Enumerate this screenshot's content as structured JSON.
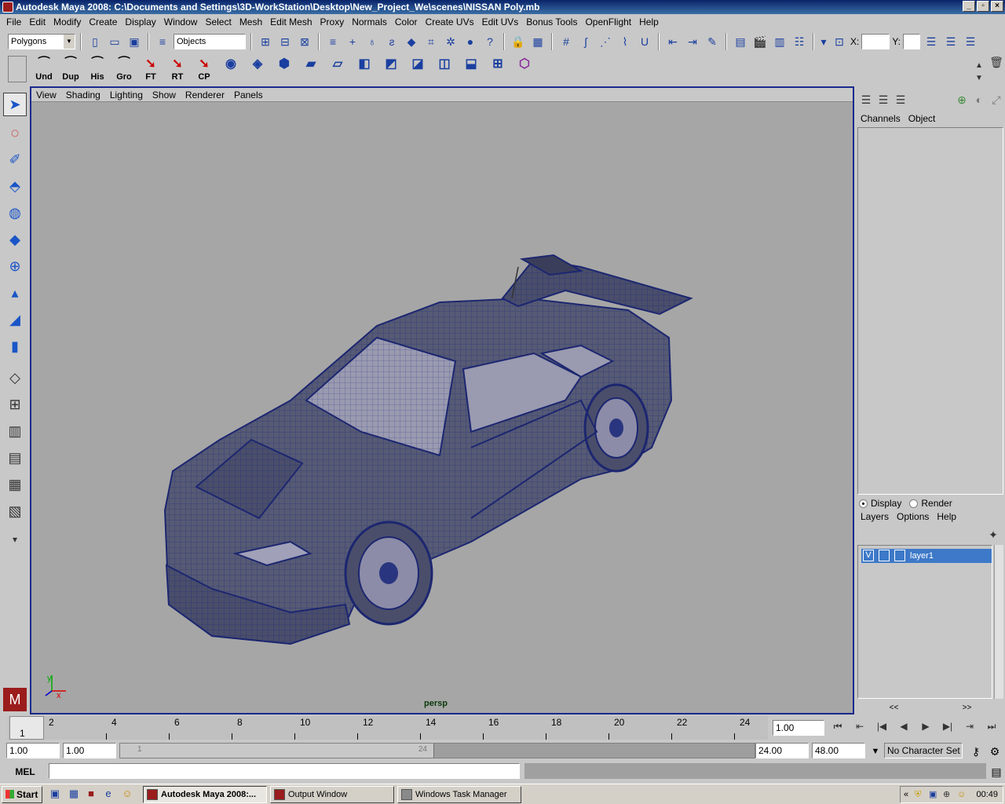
{
  "window": {
    "title": "Autodesk Maya 2008: C:\\Documents and Settings\\3D-WorkStation\\Desktop\\New_Project_We\\scenes\\NISSAN Poly.mb",
    "min": "_",
    "max": "▫",
    "close": "×"
  },
  "menus": [
    "File",
    "Edit",
    "Modify",
    "Create",
    "Display",
    "Window",
    "Select",
    "Mesh",
    "Edit Mesh",
    "Proxy",
    "Normals",
    "Color",
    "Create UVs",
    "Edit UVs",
    "Bonus Tools",
    "OpenFlight",
    "Help"
  ],
  "statusline": {
    "mode": "Polygons",
    "select_field": "Objects",
    "x_label": "X:",
    "y_label": "Y:"
  },
  "shelf": [
    {
      "label": "Und"
    },
    {
      "label": "Dup"
    },
    {
      "label": "His"
    },
    {
      "label": "Gro"
    },
    {
      "label": "FT"
    },
    {
      "label": "RT"
    },
    {
      "label": "CP"
    }
  ],
  "panel_menu": [
    "View",
    "Shading",
    "Lighting",
    "Show",
    "Renderer",
    "Panels"
  ],
  "viewport": {
    "camera": "persp",
    "axis_x": "x",
    "axis_y": "y"
  },
  "channel_box": {
    "tabs": [
      "Channels",
      "Object"
    ]
  },
  "layer_editor": {
    "display": "Display",
    "render": "Render",
    "menu": [
      "Layers",
      "Options",
      "Help"
    ],
    "layer_visible": "V",
    "layer_name": "layer1",
    "prev": "<<",
    "next": ">>"
  },
  "timeline": {
    "current_frame": "1",
    "ticks": [
      "2",
      "4",
      "6",
      "8",
      "10",
      "12",
      "14",
      "16",
      "18",
      "20",
      "22",
      "24"
    ],
    "current_time_field": "1.00"
  },
  "range": {
    "start": "1.00",
    "playback_start": "1.00",
    "handle_start": "1",
    "handle_end": "24",
    "playback_end": "24.00",
    "end": "48.00",
    "character_set": "No Character Set"
  },
  "mel": {
    "label": "MEL"
  },
  "taskbar": {
    "start": "Start",
    "tasks": [
      "Autodesk Maya 2008:...",
      "Output Window",
      "Windows Task Manager"
    ],
    "tray_arrows": "«",
    "clock": "00:49"
  }
}
